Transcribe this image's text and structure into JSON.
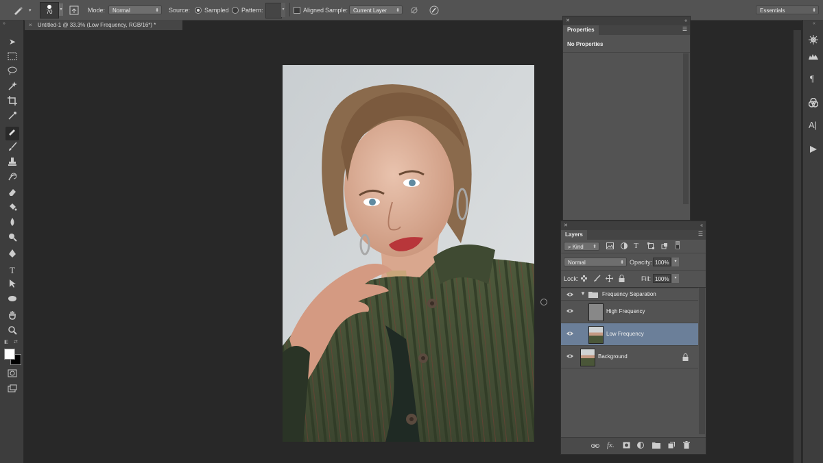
{
  "options_bar": {
    "brush_size": "70",
    "mode_label": "Mode:",
    "mode_value": "Normal",
    "source_label": "Source:",
    "sampled_label": "Sampled",
    "pattern_label": "Pattern:",
    "aligned_label": "Aligned",
    "sample_label": "Sample:",
    "sample_value": "Current Layer",
    "workspace": "Essentials"
  },
  "document": {
    "tab_title": "Untitled-1 @ 33.3% (Low Frequency, RGB/16*) *",
    "close_glyph": "×"
  },
  "properties_panel": {
    "tab": "Properties",
    "message": "No Properties"
  },
  "layers_panel": {
    "tab": "Layers",
    "filter_kind": "Kind",
    "blend_mode": "Normal",
    "opacity_label": "Opacity:",
    "opacity_value": "100%",
    "lock_label": "Lock:",
    "fill_label": "Fill:",
    "fill_value": "100%",
    "layers": [
      {
        "name": "Frequency Separation",
        "type": "group"
      },
      {
        "name": "High Frequency",
        "type": "layer"
      },
      {
        "name": "Low Frequency",
        "type": "layer",
        "selected": true
      },
      {
        "name": "Background",
        "type": "layer",
        "locked": true
      }
    ]
  },
  "colors": {
    "selected_layer": "#6b7f99",
    "panel": "#535353",
    "workspace_bg": "#282828"
  }
}
